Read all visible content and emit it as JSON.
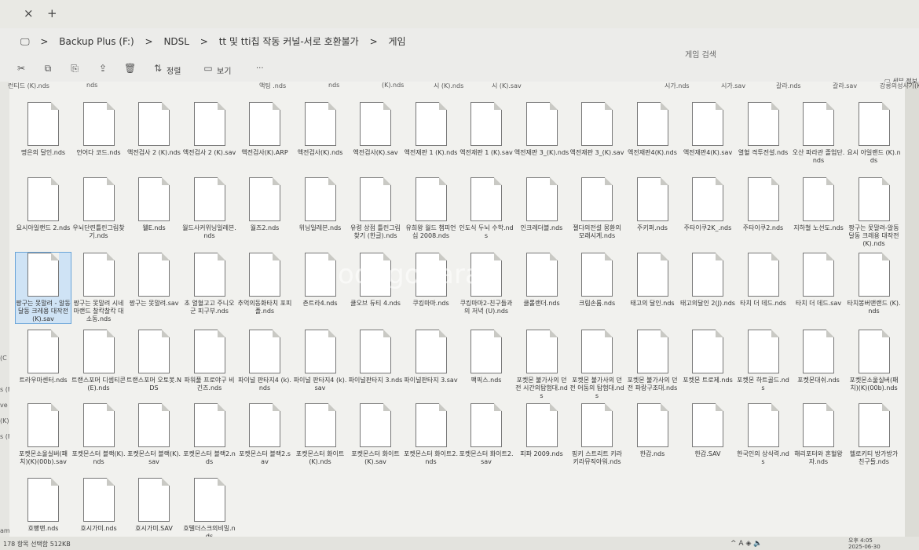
{
  "window": {
    "tab_close": "×",
    "tab_new": "+"
  },
  "breadcrumb": [
    "Backup Plus (F:)",
    "NDSL",
    "tt 및 tti칩 작동 커널-서로 호환불가",
    "게임"
  ],
  "breadcrumb_sep": ">",
  "search_placeholder": "게임 검색",
  "toolbar": {
    "sort_label": "정렬",
    "view_label": "보기",
    "more_label": "···"
  },
  "detail_pane_label": "세부 정보",
  "status_text": "178 항목 선택함 512KB",
  "watermark": "Joongonara",
  "clock": {
    "time": "오후 4:05",
    "date": "2025-06-30"
  },
  "top_clipped": [
    "런티드 (K).nds",
    "nds",
    "액팅 .nds",
    "nds",
    "(K).nds",
    "시 (K).nds",
    "시 (K).sav",
    "시가.nds",
    "시가.sav",
    "갈라.nds",
    "갈라.sav",
    "강릉의성사기(K).NDS"
  ],
  "side_labels": [
    "(C",
    "s (F",
    "ve :",
    "(K)",
    "s (F:",
    "am"
  ],
  "files": [
    [
      "명은의 달인.nds",
      "언어다 코드.nds",
      "액전검사 2 (K).nds",
      "액전검사 2 (K).sav",
      "액전검사(K).ARP",
      "액전검사(K).nds",
      "액전검사(K).sav",
      "액전재판 1 (K).nds",
      "액전재판 1 (K).sav",
      "액전재판 3_(K).nds",
      "액전재판 3_(K).sav",
      "액전재판4(K).nds",
      "액전재판4(K).sav",
      "열혈 격투전설.nds",
      "오산 파라관 졸업단.nds",
      "요시 아일랜드 (K).nds"
    ],
    [
      "요시아일랜드 2.nds",
      "우뇌단련틀린그림찾기.nds",
      "웰E.nds",
      "월드사커위닝일레븐.nds",
      "월즈2.nds",
      "위닝일레븐.nds",
      "유령 상점 틀린그림찾기 (한글).nds",
      "유희왕 월드 챔피언십 2008.nds",
      "인도식 두뇌 수학.nds",
      "인크레더블.nds",
      "젤다의전설 몽환의 모래시계.nds",
      "주키퍼.nds",
      "주타이쿠2K_.nds",
      "주타이쿠2.nds",
      "지하철 노선도.nds",
      "짱구는 못말려-알동달동 크레용 대작전(K).nds"
    ],
    [
      "짱구는 못말려 - 알동달동 크레용 대작전(K).sav",
      "짱구는 못말려 시네마랜드 찰칵찰칵 대소동.nds",
      "짱구는 못말려.sav",
      "초 열혈고고 주니오군 피구부.nds",
      "추억의동화타치 포피플.nds",
      "촌트라4.nds",
      "쿨오브 듀티 4.nds",
      "쿠킹마마.nds",
      "쿠킹마마2-친구들과의 저녁 (U).nds",
      "쿨롤랜더.nds",
      "크림손룸.nds",
      "태고의 달인.nds",
      "태고의달인 2(J).nds",
      "타치 더 데드.nds",
      "타치 더 데드.sav",
      "타치봉버맨랜드 (K).nds"
    ],
    [
      "트라우마센터.nds",
      "트랜스포머 디셉티콘(E).nds",
      "트랜스포머 오토봇.NDS",
      "파워풀 프로야구 비긴즈.nds",
      "파이널 판타지4 (k).nds",
      "파이널 판타지4 (k).sav",
      "파이널판타지 3.nds",
      "파이널판타지 3.sav",
      "팩픽스.nds",
      "포켓몬 불가사의 던전 시간의탐험대.nds",
      "포켓몬 불가사의 던전 어둠의 탐험대.nds",
      "포켓몬 불가사의 던전 파랑구조대.nds",
      "포켓몬 트로제.nds",
      "포켓몬 하트골드.nds",
      "포켓몬대쉬.nds",
      "포켓몬소울실버(패치)(K)(00b).nds"
    ],
    [
      "포켓몬소울실버(패치)(K)(00b).sav",
      "포켓몬스터 블랙(K).nds",
      "포켓몬스터 블랙(K).sav",
      "포켓몬스터 블랙2.nds",
      "포켓몬스터 블랙2.sav",
      "포켓몬스터 화이트(K).nds",
      "포켓몬스터 화이트(K).sav",
      "포켓몬스터 화이트2.nds",
      "포켓몬스터 화이트2.sav",
      "피파 2009.nds",
      "핑키 스트리트 키라키라뮤직아워.nds",
      "한갑.nds",
      "한갑.SAV",
      "한국인의 상식력.nds",
      "해리포터와 혼혈왕자.nds",
      "헬로키티 방가방가 친구들.nds"
    ],
    [
      "호빵맨.nds",
      "호시가미.nds",
      "호시가미.SAV",
      "호텔더스크의비밀.nds"
    ]
  ]
}
